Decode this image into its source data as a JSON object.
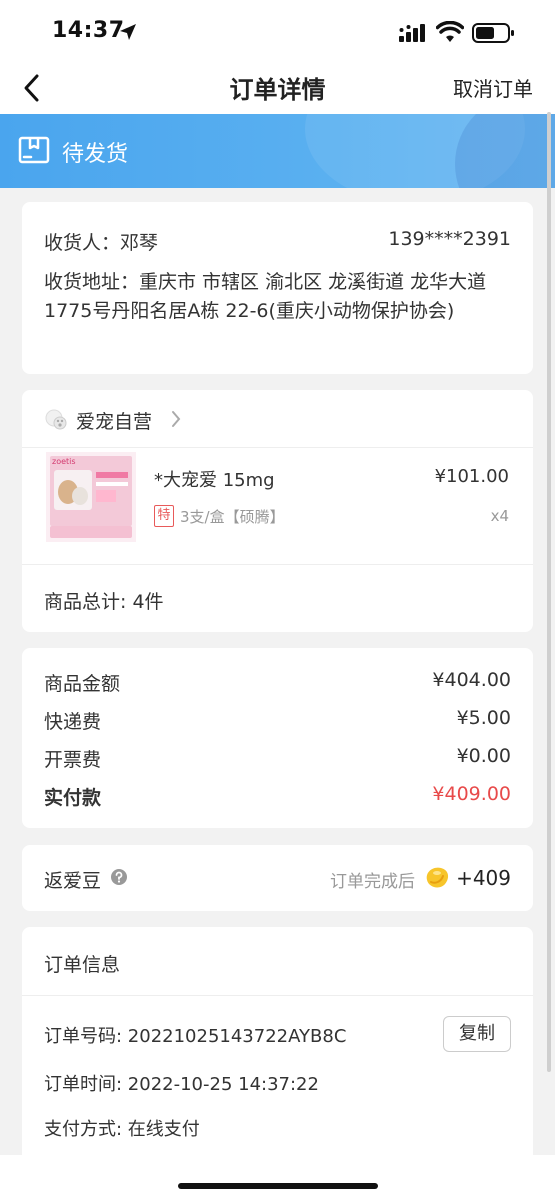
{
  "status_bar": {
    "time": "14:37"
  },
  "nav": {
    "title": "订单详情",
    "cancel_label": "取消订单"
  },
  "banner": {
    "status_text": "待发货"
  },
  "address": {
    "receiver": "收货人：邓琴",
    "phone": "139****2391",
    "address": "收货地址：重庆市 市辖区 渝北区 龙溪街道 龙华大道1775号丹阳名居A栋 22-6(重庆小动物保护协会)"
  },
  "goods": {
    "shop_name": "爱宠自营",
    "product": {
      "name": "*大宠爱 15mg",
      "price": "¥101.00",
      "tag": "特",
      "spec": "3支/盒【硕腾】",
      "qty": "x4",
      "brand_text": "zoetis"
    },
    "total": "商品总计: 4件"
  },
  "prices": [
    {
      "label": "商品金额",
      "value": "¥404.00"
    },
    {
      "label": "快递费",
      "value": "¥5.00"
    },
    {
      "label": "开票费",
      "value": "¥0.00"
    },
    {
      "label": "实付款",
      "value": "¥409.00"
    }
  ],
  "beans": {
    "label": "返爱豆",
    "note": "订单完成后",
    "value": "+409"
  },
  "order_info": {
    "title": "订单信息",
    "order_no": "订单号码: 20221025143722AYB8C",
    "copy_label": "复制",
    "order_time": "订单时间: 2022-10-25 14:37:22",
    "pay_method": "支付方式: 在线支付"
  },
  "colors": {
    "banner": "#4aa5ee",
    "accent_red": "#e84a4a",
    "muted": "#999999"
  }
}
